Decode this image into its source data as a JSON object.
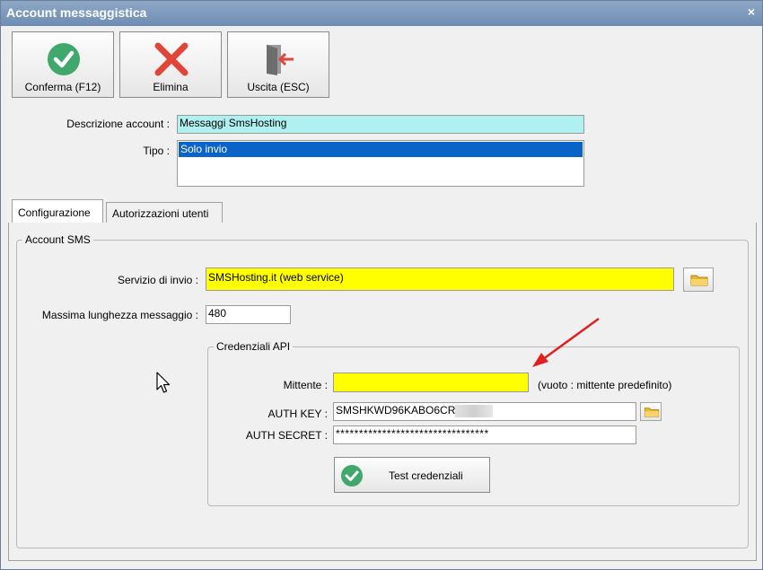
{
  "window": {
    "title": "Account messaggistica",
    "close_symbol": "×"
  },
  "toolbar": {
    "confirm_label": "Conferma (F12)",
    "delete_label": "Elimina",
    "exit_label": "Uscita (ESC)"
  },
  "form": {
    "description_label": "Descrizione account :",
    "description_value": "Messaggi SmsHosting",
    "type_label": "Tipo :",
    "type_options": [
      "Solo invio"
    ]
  },
  "tabs": [
    {
      "label": "Configurazione",
      "active": true
    },
    {
      "label": "Autorizzazioni utenti",
      "active": false
    }
  ],
  "account_sms": {
    "group_title": "Account SMS",
    "service_label": "Servizio di invio :",
    "service_value": "SMSHosting.it (web service)",
    "max_length_label": "Massima lunghezza messaggio :",
    "max_length_value": "480"
  },
  "credentials": {
    "group_title": "Credenziali API",
    "sender_label": "Mittente :",
    "sender_value": "",
    "sender_hint": "(vuoto : mittente predefinito)",
    "auth_key_label": "AUTH KEY :",
    "auth_key_value": "SMSHKWD96KABO6CR",
    "auth_secret_label": "AUTH SECRET :",
    "auth_secret_value": "*********************************",
    "test_button_label": "Test credenziali"
  },
  "colors": {
    "highlight_cyan": "#aff0f0",
    "selection_blue": "#0a64c8",
    "required_yellow": "#ffff00",
    "confirm_green": "#3fa86a",
    "delete_red": "#e0453a",
    "annotation_arrow": "#e02020"
  },
  "icons": {
    "confirm": "check-circle-icon",
    "delete": "red-x-icon",
    "exit": "exit-door-icon",
    "folder": "folder-icon",
    "test": "check-circle-icon"
  }
}
